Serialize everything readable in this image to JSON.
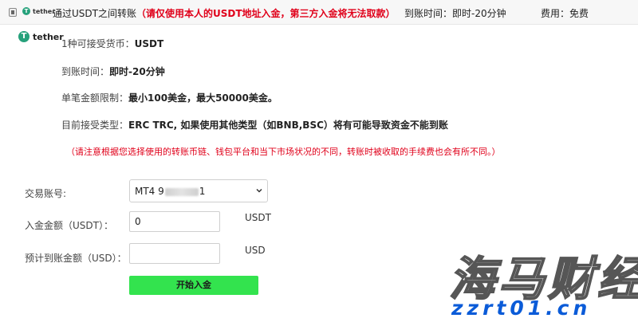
{
  "topbar": {
    "logo_text": "tether",
    "title": "通过USDT之间转账",
    "warning": "（请仅使用本人的USDT地址入金，第三方入金将无法取款）",
    "arrival": "到账时间：即时-20分钟",
    "fee": "费用：免费"
  },
  "logo": {
    "symbol": "T",
    "text": "tether"
  },
  "info": {
    "currency_label": "1种可接受货币：",
    "currency_value": "USDT",
    "arrival_label": "到账时间：",
    "arrival_value": "即时-20分钟",
    "limit_label": "单笔金额限制：",
    "limit_value": "最小100美金，最大50000美金。",
    "type_label": "目前接受类型：",
    "type_value": "ERC TRC, 如果使用其他类型（如BNB,BSC）将有可能导致资金不能到账"
  },
  "note": "（请注意根据您选择使用的转账币链、钱包平台和当下市场状况的不同，转账时被收取的手续费也会有所不同。）",
  "form": {
    "account_label": "交易账号:",
    "account_prefix": "MT4 9",
    "account_suffix": "1",
    "amount_label": "入金金额（USDT）：",
    "amount_value": "0",
    "amount_unit": "USDT",
    "est_label": "预计到账金额（USD）：",
    "est_value": "",
    "est_unit": "USD",
    "submit_label": "开始入金"
  },
  "watermark": {
    "cn": "海马财经",
    "url": "zzrt01.cn"
  },
  "colors": {
    "warning": "#e0001a",
    "button": "#33e34e",
    "tether": "#26a17b",
    "watermark_url": "#0a5bd8"
  }
}
